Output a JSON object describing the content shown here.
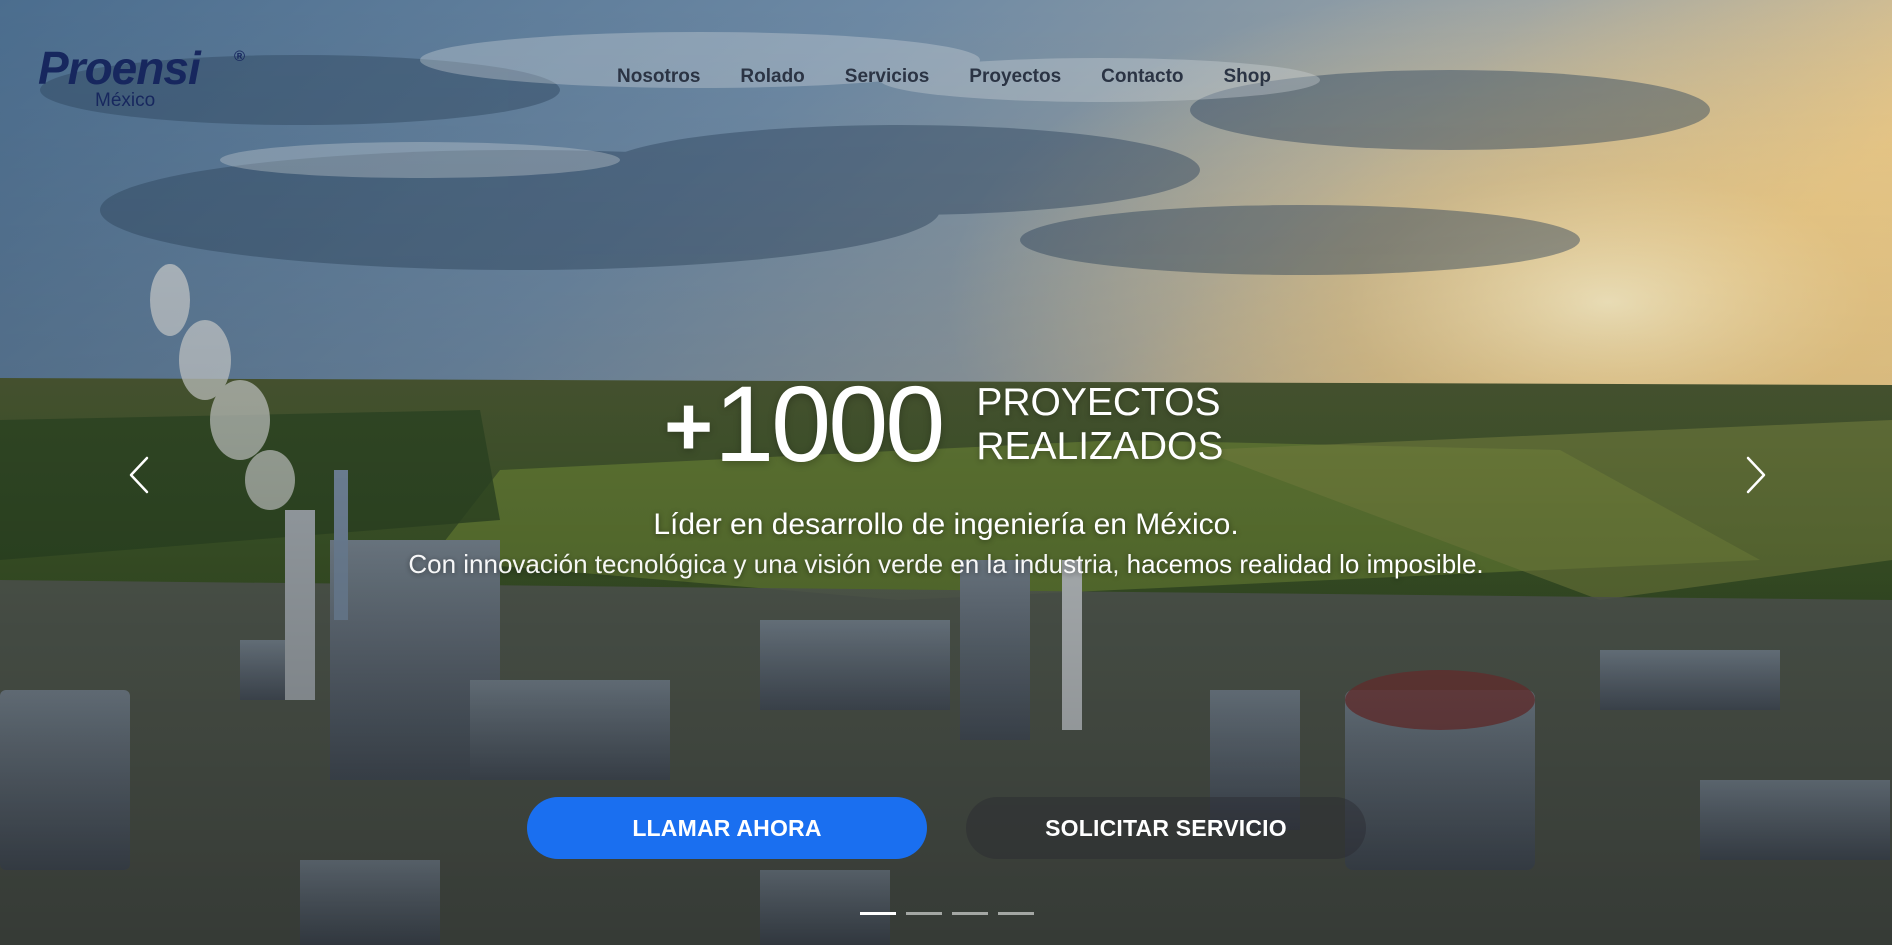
{
  "logo": {
    "brand": "Proensi",
    "registered": "®",
    "region": "México"
  },
  "nav": {
    "items": [
      {
        "label": "Nosotros"
      },
      {
        "label": "Rolado"
      },
      {
        "label": "Servicios"
      },
      {
        "label": "Proyectos"
      },
      {
        "label": "Contacto"
      },
      {
        "label": "Shop"
      }
    ]
  },
  "hero": {
    "plus": "+",
    "number": "1000",
    "headline_line1": "PROYECTOS",
    "headline_line2": "REALIZADOS",
    "tagline1": "Líder en desarrollo de ingeniería en México.",
    "tagline2_light": "Con innovación tecnológica y una visión verde en la industria, ",
    "tagline2_strong": "hacemos realidad lo imposible."
  },
  "buttons": {
    "call_label": "LLAMAR AHORA",
    "request_label": "SOLICITAR SERVICIO"
  },
  "carousel": {
    "prev_icon": "chevron-left-icon",
    "next_icon": "chevron-right-icon",
    "slides_count": 4,
    "active_slide": 1
  },
  "colors": {
    "brand_navy": "#17275e",
    "nav_text": "#2b3444",
    "primary_button": "#1a6ff0"
  }
}
